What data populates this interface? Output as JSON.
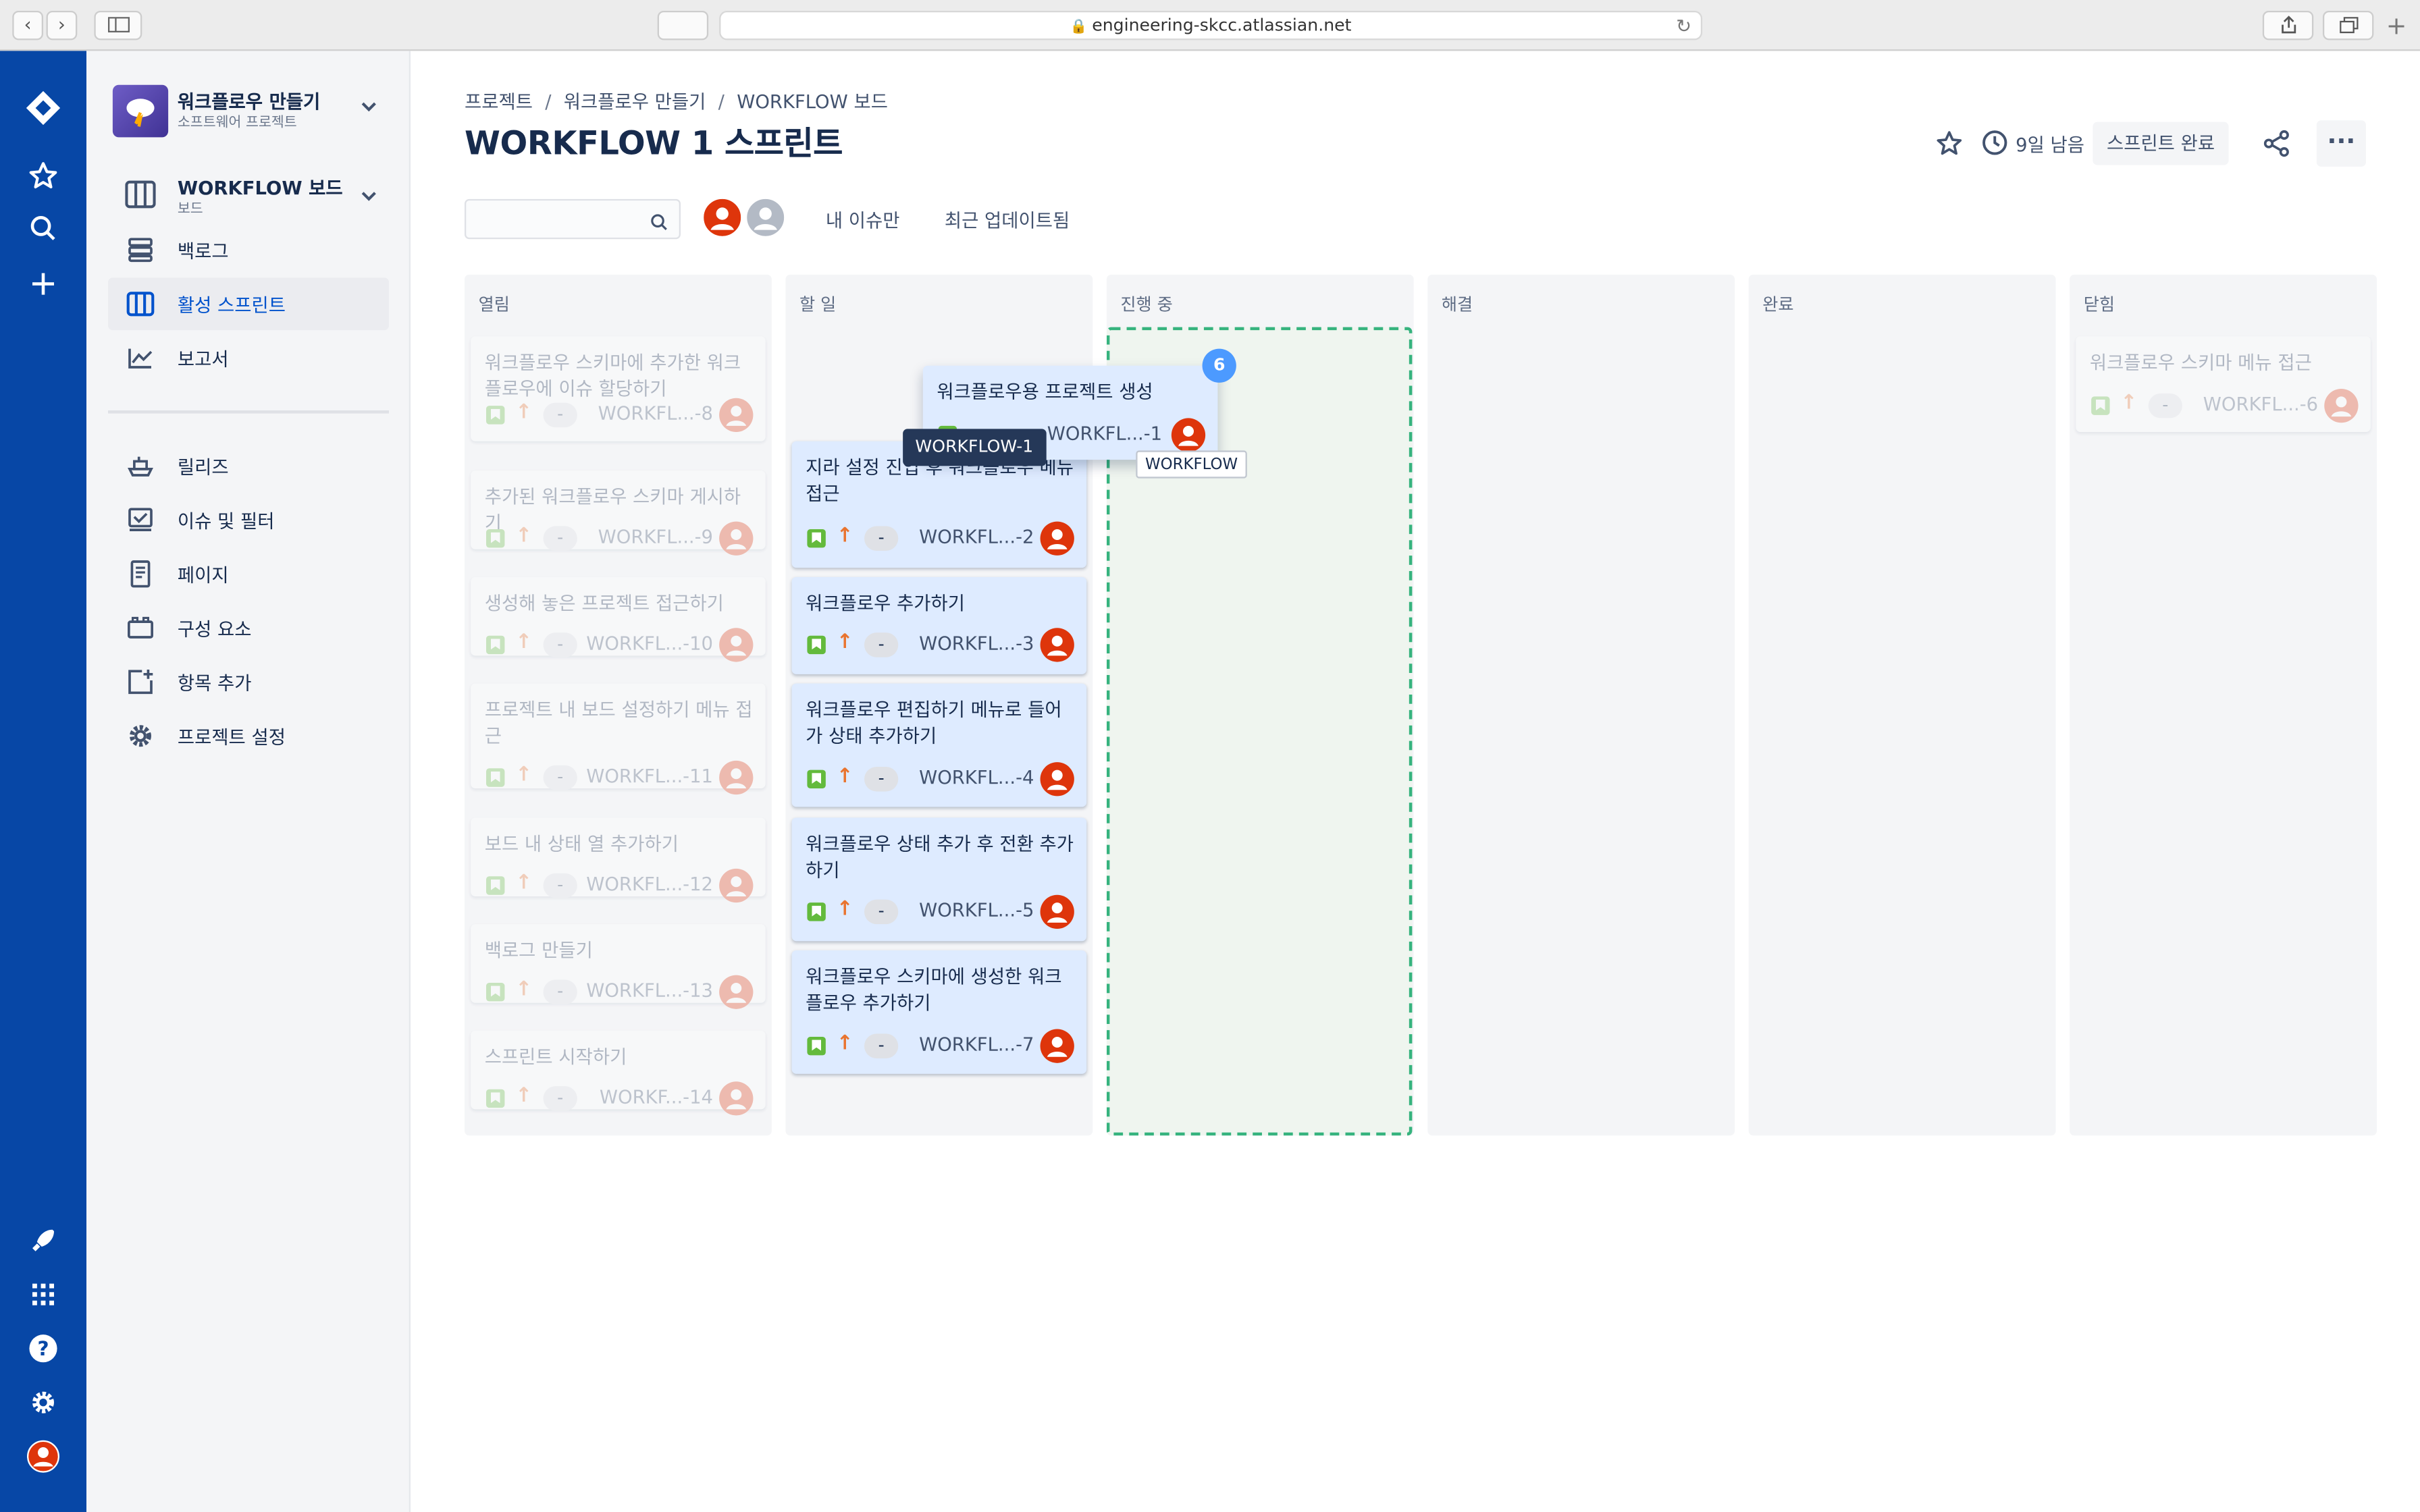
{
  "browser": {
    "url": "engineering-skcc.atlassian.net"
  },
  "project": {
    "name": "워크플로우 만들기",
    "type": "소프트웨어 프로젝트",
    "board_name": "WORKFLOW 보드",
    "board_sub": "보드"
  },
  "sidebar": {
    "items": [
      {
        "label": "백로그"
      },
      {
        "label": "활성 스프린트"
      },
      {
        "label": "보고서"
      },
      {
        "label": "릴리즈"
      },
      {
        "label": "이슈 및 필터"
      },
      {
        "label": "페이지"
      },
      {
        "label": "구성 요소"
      },
      {
        "label": "항목 추가"
      },
      {
        "label": "프로젝트 설정"
      }
    ]
  },
  "breadcrumb": [
    "프로젝트",
    "워크플로우 만들기",
    "WORKFLOW 보드"
  ],
  "page": {
    "title": "WORKFLOW 1 스프린트",
    "time_remaining": "9일 남음",
    "complete_sprint": "스프린트 완료"
  },
  "filters": {
    "my_issues": "내 이슈만",
    "recently_updated": "최근 업데이트됨"
  },
  "columns": [
    {
      "name": "열림",
      "cards": [
        {
          "title": "워크플로우 스키마에 추가한 워크플로우에 이슈 할당하기",
          "key": "WORKFL...-8",
          "estimate": "-"
        },
        {
          "title": "추가된 워크플로우 스키마 게시하기",
          "key": "WORKFL...-9",
          "estimate": "-"
        },
        {
          "title": "생성해 놓은 프로젝트 접근하기",
          "key": "WORKFL...-10",
          "estimate": "-"
        },
        {
          "title": "프로젝트 내 보드 설정하기 메뉴 접근",
          "key": "WORKFL...-11",
          "estimate": "-"
        },
        {
          "title": "보드 내 상태 열 추가하기",
          "key": "WORKFL...-12",
          "estimate": "-"
        },
        {
          "title": "백로그 만들기",
          "key": "WORKFL...-13",
          "estimate": "-"
        },
        {
          "title": "스프린트 시작하기",
          "key": "WORKF...-14",
          "estimate": "-"
        }
      ]
    },
    {
      "name": "할 일",
      "cards": [
        {
          "title": "지라 설정 진입 후 워크플로우 메뉴 접근",
          "key": "WORKFL...-2",
          "estimate": "-"
        },
        {
          "title": "워크플로우 추가하기",
          "key": "WORKFL...-3",
          "estimate": "-"
        },
        {
          "title": "워크플로우 편집하기 메뉴로 들어가 상태 추가하기",
          "key": "WORKFL...-4",
          "estimate": "-"
        },
        {
          "title": "워크플로우 상태 추가 후 전환 추가하기",
          "key": "WORKFL...-5",
          "estimate": "-"
        },
        {
          "title": "워크플로우 스키마에 생성한 워크플로우 추가하기",
          "key": "WORKFL...-7",
          "estimate": "-"
        }
      ]
    },
    {
      "name": "진행 중",
      "cards": []
    },
    {
      "name": "해결",
      "cards": []
    },
    {
      "name": "완료",
      "cards": []
    },
    {
      "name": "닫힘",
      "cards": [
        {
          "title": "워크플로우 스키마 메뉴 접근",
          "key": "WORKFL...-6",
          "estimate": "-"
        }
      ]
    }
  ],
  "dragging": {
    "title": "워크플로우용 프로젝트 생성",
    "key": "WORKFL...-1",
    "badge": "6",
    "tooltip_key": "WORKFLOW-1",
    "tooltip_project": "WORKFLOW"
  },
  "colors": {
    "global_nav": "#0747a6",
    "active_item": "#0052cc",
    "story": "#63ba3c",
    "priority": "#e9742f",
    "avatar": "#de350b",
    "dropzone_border": "#36b37e"
  }
}
